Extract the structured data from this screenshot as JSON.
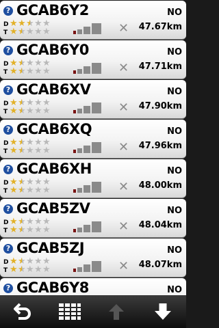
{
  "caches": [
    {
      "code": "GCAB6Y2",
      "found": "NO",
      "distance": "47.67km",
      "difficulty": 2.5,
      "terrain": 1.5,
      "size_level": 3
    },
    {
      "code": "GCAB6Y0",
      "found": "NO",
      "distance": "47.71km",
      "difficulty": 1.5,
      "terrain": 1.5,
      "size_level": 3
    },
    {
      "code": "GCAB6XV",
      "found": "NO",
      "distance": "47.90km",
      "difficulty": 1.5,
      "terrain": 1.5,
      "size_level": 3
    },
    {
      "code": "GCAB6XQ",
      "found": "NO",
      "distance": "47.96km",
      "difficulty": 1.5,
      "terrain": 1.5,
      "size_level": 3
    },
    {
      "code": "GCAB6XH",
      "found": "NO",
      "distance": "48.00km",
      "difficulty": 1.5,
      "terrain": 1.5,
      "size_level": 3
    },
    {
      "code": "GCAB5ZV",
      "found": "NO",
      "distance": "48.04km",
      "difficulty": 1.5,
      "terrain": 1.5,
      "size_level": 3
    },
    {
      "code": "GCAB5ZJ",
      "found": "NO",
      "distance": "48.07km",
      "difficulty": 1.5,
      "terrain": 1.5,
      "size_level": 3
    },
    {
      "code": "GCAB6Y8",
      "found": "NO",
      "distance": "",
      "difficulty": 1.5,
      "terrain": 1.5,
      "size_level": 3
    }
  ],
  "labels": {
    "difficulty": "D",
    "terrain": "T",
    "unknown_type": "?"
  },
  "colors": {
    "star": "#e2b128",
    "star_empty": "#b9b9b9",
    "size_active": "#7a1414",
    "size_inactive": "#8a8a8a",
    "type_icon": "#1f4fa0"
  },
  "toolbar": {
    "icons": [
      "back-arrow-icon",
      "list-grid-icon",
      "up-arrow-icon",
      "down-arrow-icon"
    ],
    "up_enabled": false
  }
}
